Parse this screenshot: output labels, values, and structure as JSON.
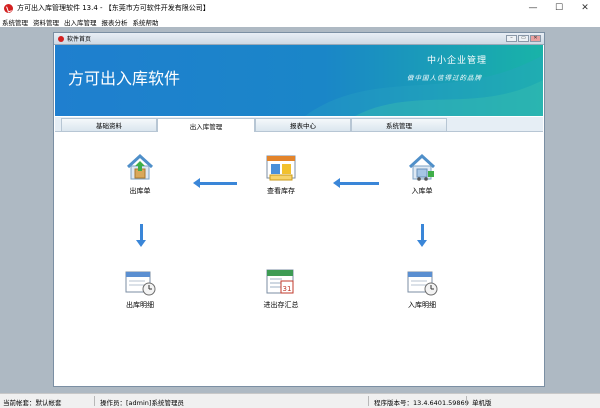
{
  "window": {
    "title": "方可出入库管理软件 13.4 - 【东莞市方可软件开发有限公司】",
    "controls": {
      "minimize": "—",
      "maximize": "☐",
      "close": "✕"
    }
  },
  "menubar": {
    "items": [
      {
        "label": "系统管理"
      },
      {
        "label": "资料管理"
      },
      {
        "label": "出入库管理"
      },
      {
        "label": "报表分析"
      },
      {
        "label": "系统帮助"
      }
    ]
  },
  "child_window": {
    "title": "软件首页",
    "controls": {
      "minimize": "–",
      "restore": "▭",
      "close": "✕"
    }
  },
  "banner": {
    "title": "方可出入库软件",
    "right_title": "中小企业管理",
    "slogan": "做中国人信得过的品牌"
  },
  "tabs": [
    {
      "label": "基础资料",
      "active": false
    },
    {
      "label": "出入库管理",
      "active": true
    },
    {
      "label": "报表中心",
      "active": false
    },
    {
      "label": "系统管理",
      "active": false
    }
  ],
  "flow": {
    "stock_out": {
      "label": "出库单",
      "icon": "house-box-icon"
    },
    "view_stock": {
      "label": "查看库存",
      "icon": "window-chart-icon"
    },
    "stock_in": {
      "label": "入库单",
      "icon": "house-cart-icon"
    },
    "out_detail": {
      "label": "出库明细",
      "icon": "calendar-clock-icon"
    },
    "summary": {
      "label": "进出存汇总",
      "icon": "calendar-31-icon"
    },
    "in_detail": {
      "label": "入库明细",
      "icon": "calendar-clock-icon"
    }
  },
  "colors": {
    "accent": "#3a86d8",
    "banner_start": "#1f7fcf",
    "banner_end": "#19b3a8"
  },
  "statusbar": {
    "account": "当前帐套：默认帐套",
    "operator": "操作员：[admin]系统管理员",
    "version": "程序版本号：13.4.6401.59869",
    "edition": "单机版"
  }
}
